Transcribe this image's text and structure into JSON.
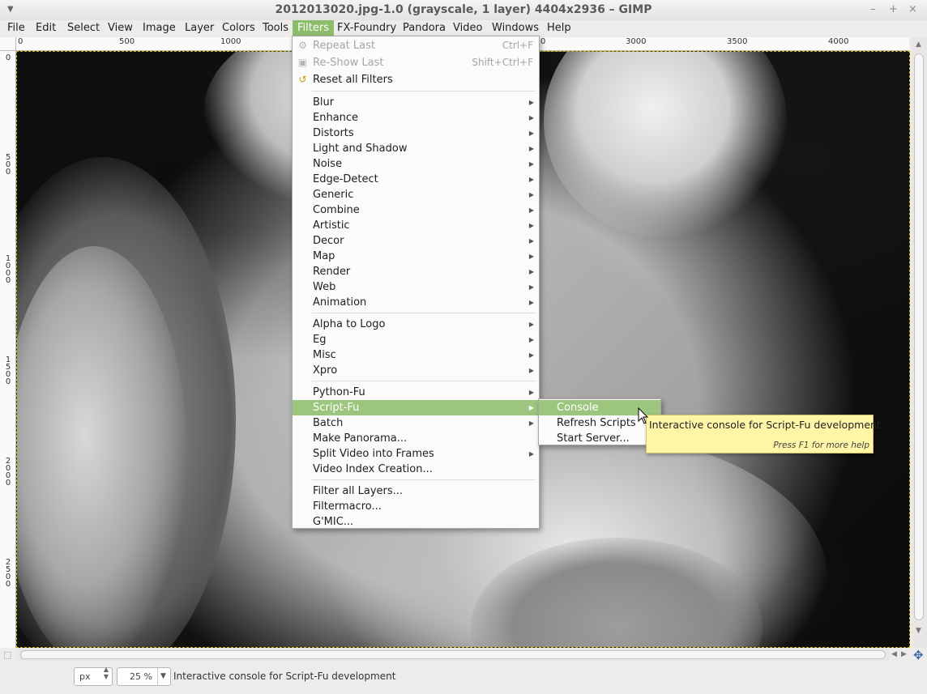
{
  "window": {
    "title": "2012013020.jpg-1.0 (grayscale, 1 layer) 4404x2936 – GIMP",
    "controls": [
      "–",
      "+",
      "×"
    ]
  },
  "menubar": {
    "items": [
      "File",
      "Edit",
      "Select",
      "View",
      "Image",
      "Layer",
      "Colors",
      "Tools",
      "Filters",
      "FX-Foundry",
      "Pandora",
      "Video",
      "Windows",
      "Help"
    ],
    "active": "Filters"
  },
  "rulers": {
    "top_labels": [
      "0",
      "500",
      "1000",
      "3000",
      "3500",
      "4000"
    ],
    "partial_label": "0",
    "left_labels": [
      "0",
      "500",
      "1000",
      "1500",
      "2000",
      "2500"
    ]
  },
  "filters_menu": {
    "items": [
      {
        "label": "Repeat Last",
        "accel": "Ctrl+F",
        "disabled": true,
        "icon": "gear-icon"
      },
      {
        "label": "Re-Show Last",
        "accel": "Shift+Ctrl+F",
        "disabled": true,
        "icon": "reshow-icon"
      },
      {
        "label": "Reset all Filters",
        "icon": "reset-icon"
      },
      {
        "label": "Blur",
        "submenu": true
      },
      {
        "label": "Enhance",
        "submenu": true
      },
      {
        "label": "Distorts",
        "submenu": true
      },
      {
        "label": "Light and Shadow",
        "submenu": true
      },
      {
        "label": "Noise",
        "submenu": true
      },
      {
        "label": "Edge-Detect",
        "submenu": true
      },
      {
        "label": "Generic",
        "submenu": true
      },
      {
        "label": "Combine",
        "submenu": true
      },
      {
        "label": "Artistic",
        "submenu": true
      },
      {
        "label": "Decor",
        "submenu": true
      },
      {
        "label": "Map",
        "submenu": true
      },
      {
        "label": "Render",
        "submenu": true
      },
      {
        "label": "Web",
        "submenu": true
      },
      {
        "label": "Animation",
        "submenu": true
      },
      {
        "label": "Alpha to Logo",
        "submenu": true
      },
      {
        "label": "Eg",
        "submenu": true
      },
      {
        "label": "Misc",
        "submenu": true
      },
      {
        "label": "Xpro",
        "submenu": true
      },
      {
        "label": "Python-Fu",
        "submenu": true
      },
      {
        "label": "Script-Fu",
        "submenu": true,
        "highlighted": true
      },
      {
        "label": "Batch",
        "submenu": true
      },
      {
        "label": "Make Panorama..."
      },
      {
        "label": "Split Video into Frames",
        "submenu": true
      },
      {
        "label": "Video Index Creation..."
      },
      {
        "label": "Filter all Layers..."
      },
      {
        "label": "Filtermacro..."
      },
      {
        "label": "G'MIC..."
      }
    ]
  },
  "scriptfu_menu": {
    "items": [
      {
        "label": "Console",
        "highlighted": true
      },
      {
        "label": "Refresh Scripts"
      },
      {
        "label": "Start Server..."
      }
    ]
  },
  "tooltip": {
    "text": "Interactive console for Script-Fu development",
    "help": "Press F1 for more help"
  },
  "statusbar": {
    "unit": "px",
    "zoom": "25 %",
    "message": "Interactive console for Script-Fu development"
  },
  "colors": {
    "highlight": "#9cc67d",
    "tooltip_bg": "#fff5a6"
  }
}
